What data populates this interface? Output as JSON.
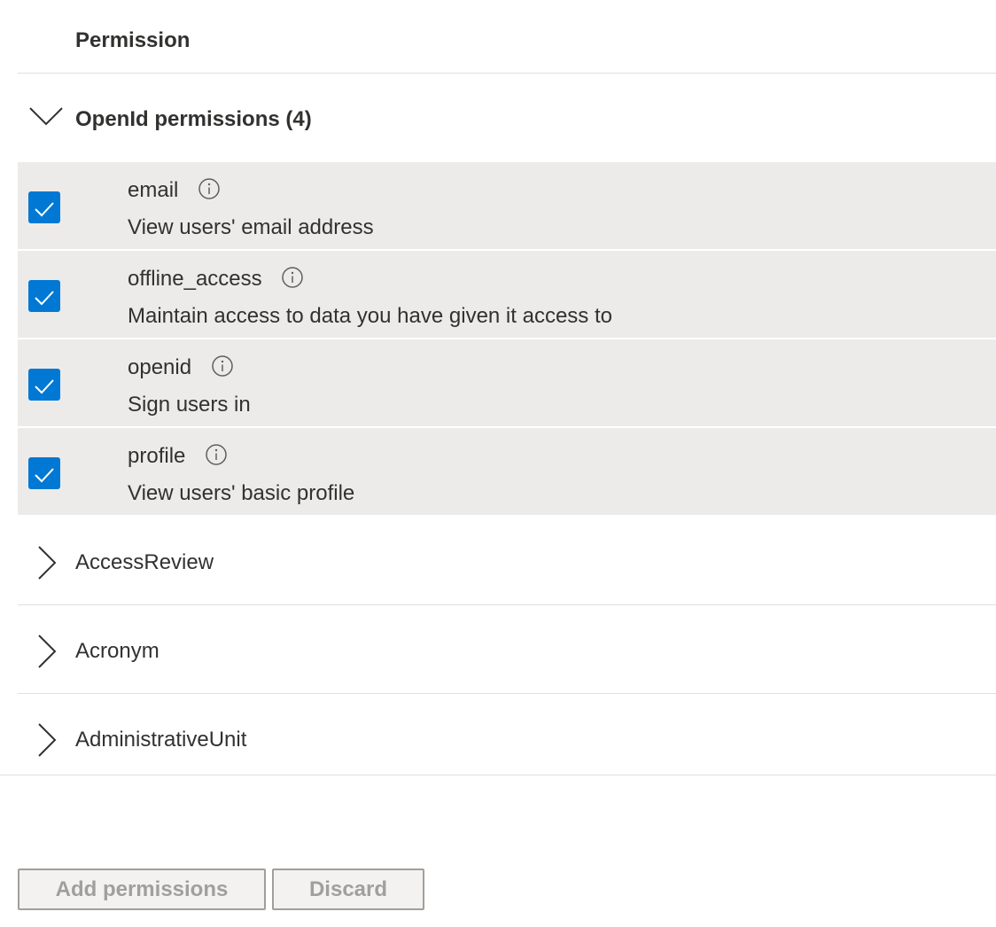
{
  "header": {
    "permission_column": "Permission"
  },
  "groups": {
    "openid": {
      "title": "OpenId permissions (4)",
      "expanded": true,
      "permissions": [
        {
          "name": "email",
          "description": "View users' email address",
          "checked": true
        },
        {
          "name": "offline_access",
          "description": "Maintain access to data you have given it access to",
          "checked": true
        },
        {
          "name": "openid",
          "description": "Sign users in",
          "checked": true
        },
        {
          "name": "profile",
          "description": "View users' basic profile",
          "checked": true
        }
      ]
    },
    "collapsed": [
      {
        "title": "AccessReview"
      },
      {
        "title": "Acronym"
      },
      {
        "title": "AdministrativeUnit"
      }
    ]
  },
  "footer": {
    "add_label": "Add permissions",
    "discard_label": "Discard"
  },
  "colors": {
    "accent": "#0078d4",
    "row_selected_bg": "#edebe9",
    "divider": "#e1dfdd",
    "disabled_text": "#a19f9d"
  },
  "icons": {
    "expanded_chevron": "chevron-down-icon",
    "collapsed_chevron": "chevron-right-icon",
    "info": "info-icon",
    "check": "checkmark-icon"
  }
}
